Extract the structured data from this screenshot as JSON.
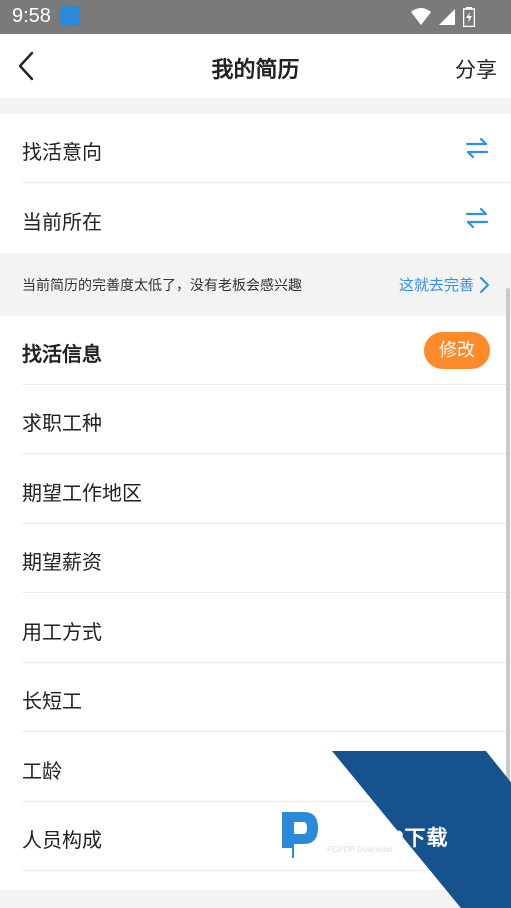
{
  "status_bar": {
    "time": "9:58"
  },
  "header": {
    "title": "我的简历",
    "share_label": "分享"
  },
  "preferences": [
    {
      "label": "找活意向"
    },
    {
      "label": "当前所在"
    }
  ],
  "notice": {
    "text": "当前简历的完善度太低了，没有老板会感兴趣",
    "link": "这就去完善"
  },
  "job_info": {
    "title": "找活信息",
    "edit_label": "修改",
    "fields": [
      {
        "label": "求职工种"
      },
      {
        "label": "期望工作地区"
      },
      {
        "label": "期望薪资"
      },
      {
        "label": "用工方式"
      },
      {
        "label": "长短工"
      },
      {
        "label": "工龄"
      },
      {
        "label": "人员构成"
      }
    ]
  },
  "watermark": {
    "text": "PCPOP下载",
    "sub": "PCPOP Download"
  },
  "colors": {
    "accent_blue": "#2f8ef0",
    "edit_orange": "#ff8a2a",
    "watermark_blue": "#16528e"
  },
  "icons": [
    "back-icon",
    "swap-icon",
    "chevron-right-icon",
    "wifi-icon",
    "signal-icon",
    "battery-icon"
  ]
}
